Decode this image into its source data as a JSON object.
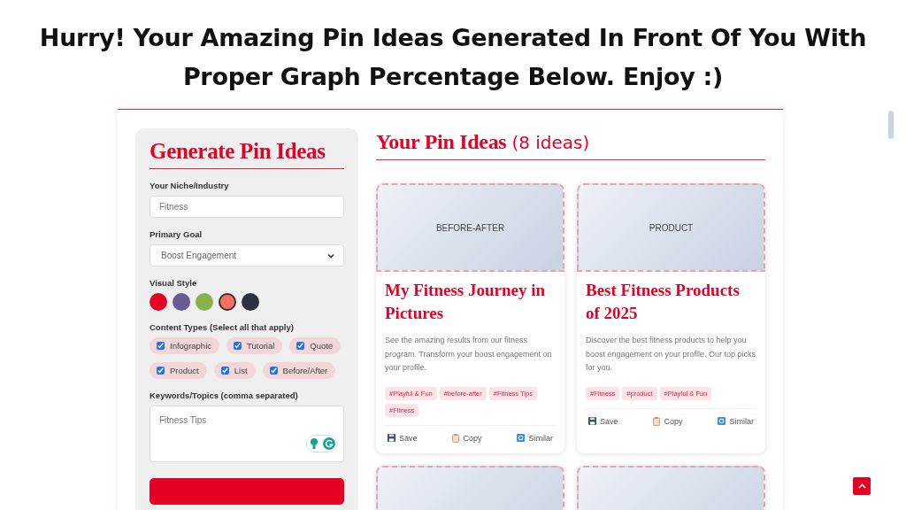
{
  "headline": "Hurry! Your Amazing Pin Ideas Generated In Front Of You With Proper Graph Percentage Below. Enjoy :)",
  "form": {
    "title": "Generate Pin Ideas",
    "niche": {
      "label": "Your Niche/Industry",
      "value": "Fitness"
    },
    "goal": {
      "label": "Primary Goal",
      "value": "Boost Engagement"
    },
    "visual_style": {
      "label": "Visual Style",
      "swatches": [
        {
          "color": "#e60023",
          "selected": false
        },
        {
          "color": "#6b5b95",
          "selected": false
        },
        {
          "color": "#88b04b",
          "selected": false
        },
        {
          "color": "#ff6f61",
          "selected": true
        },
        {
          "color": "#2d3142",
          "selected": false
        }
      ]
    },
    "content_types": {
      "label": "Content Types (Select all that apply)",
      "options": [
        {
          "label": "Infographic",
          "checked": true
        },
        {
          "label": "Tutorial",
          "checked": true
        },
        {
          "label": "Quote",
          "checked": true
        },
        {
          "label": "Product",
          "checked": true
        },
        {
          "label": "List",
          "checked": true
        },
        {
          "label": "Before/After",
          "checked": true
        }
      ]
    },
    "keywords": {
      "label": "Keywords/Topics (comma separated)",
      "value": "Fitness Tips"
    }
  },
  "results": {
    "title": "Your Pin Ideas",
    "count": "(8 ideas)",
    "cards": [
      {
        "kind": "full",
        "image_label": "BEFORE-AFTER",
        "title": "My Fitness Journey in Pictures",
        "description": "See the amazing results from our fitness program. Transform your boost engagement on your profile.",
        "tags": [
          "#Playful & Fun",
          "#before-after",
          "#Fitness Tips",
          "#Fitness"
        ],
        "actions": [
          "Save",
          "Copy",
          "Similar"
        ]
      },
      {
        "kind": "full",
        "image_label": "PRODUCT",
        "title": "Best Fitness Products of 2025",
        "description": "Discover the best fitness products to help you boost engagement on your profile. Our top picks for you.",
        "tags": [
          "#Fitness",
          "#product",
          "#Playful & Fun"
        ],
        "actions": [
          "Save",
          "Copy",
          "Similar"
        ]
      },
      {
        "kind": "cut-off"
      },
      {
        "kind": "cut-off"
      }
    ]
  }
}
